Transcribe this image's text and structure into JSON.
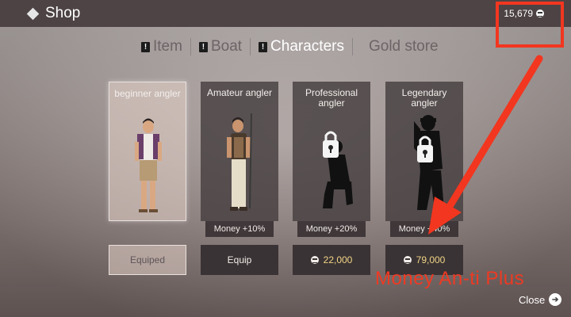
{
  "header": {
    "title": "Shop",
    "gold": "15,679"
  },
  "tabs": [
    {
      "label": "Item",
      "warning": "!",
      "active": false
    },
    {
      "label": "Boat",
      "warning": "!",
      "active": false
    },
    {
      "label": "Characters",
      "warning": "!",
      "active": true
    },
    {
      "label": "Gold store",
      "active": false
    }
  ],
  "cards": [
    {
      "title": "beginner angler",
      "action": "Equiped",
      "state": "equipped"
    },
    {
      "title": "Amateur angler",
      "bonus": "Money +10%",
      "action": "Equip",
      "state": "owned"
    },
    {
      "title": "Professional angler",
      "bonus": "Money +20%",
      "price": "22,000",
      "state": "locked"
    },
    {
      "title": "Legendary angler",
      "bonus": "Money +40%",
      "price": "79,000",
      "state": "locked"
    }
  ],
  "overlay": {
    "annotation": "Money An-ti Plus",
    "color": "#ee3a22"
  },
  "footer": {
    "close_label": "Close"
  }
}
